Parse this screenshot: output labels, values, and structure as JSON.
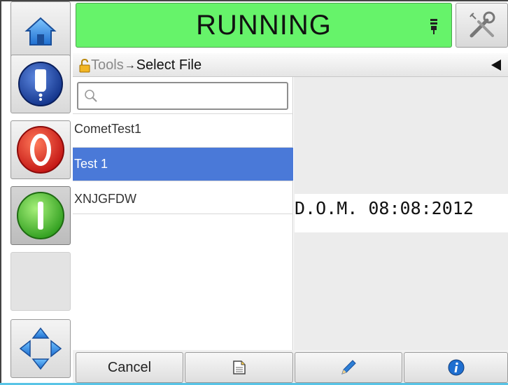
{
  "status": {
    "text": "RUNNING",
    "color": "#66f36a"
  },
  "breadcrumb": {
    "parent": "Tools",
    "separator": "→",
    "current": "Select File"
  },
  "search": {
    "value": "",
    "icon": "magnifier-icon"
  },
  "files": [
    {
      "name": "CometTest1",
      "selected": false
    },
    {
      "name": "Test 1",
      "selected": true
    },
    {
      "name": "XNJGFDW",
      "selected": false
    }
  ],
  "preview": {
    "text": "D.O.M. 08:08:2012"
  },
  "bottom": {
    "cancel_label": "Cancel"
  },
  "icons": {
    "home": "home-icon",
    "ink": "ink-cartridge-icon",
    "stop": "stop-icon",
    "start": "start-icon",
    "nav": "navigation-arrows-icon",
    "tools": "tools-icon",
    "lock": "lock-icon",
    "back": "back-arrow-icon",
    "file": "file-icon",
    "edit": "pencil-icon",
    "info": "info-icon",
    "printhead": "printhead-icon"
  },
  "colors": {
    "selection": "#4a79d8",
    "running": "#66f36a"
  }
}
